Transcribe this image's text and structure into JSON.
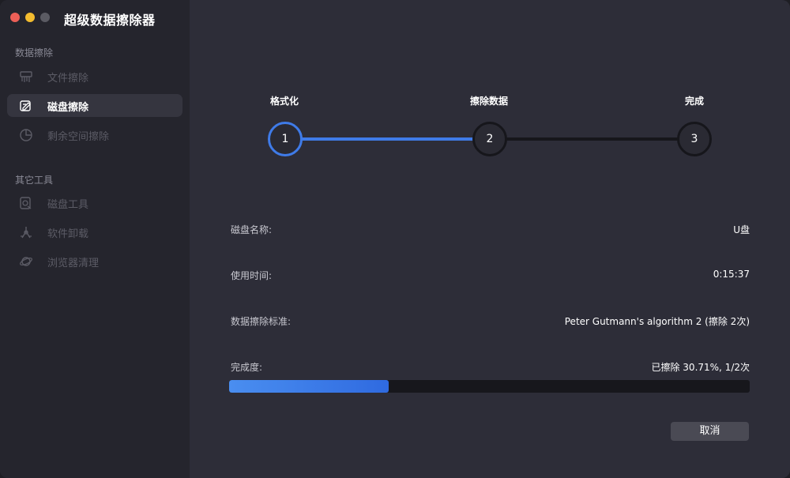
{
  "window": {
    "title": "超级数据擦除器",
    "traffic_lights": [
      "close",
      "minimize",
      "zoom"
    ]
  },
  "sidebar": {
    "sections": [
      {
        "title": "数据擦除",
        "items": [
          {
            "label": "文件擦除",
            "icon": "shredder-icon",
            "active": false
          },
          {
            "label": "磁盘擦除",
            "icon": "disk-edit-icon",
            "active": true
          },
          {
            "label": "剩余空间擦除",
            "icon": "pie-chart-icon",
            "active": false
          }
        ]
      },
      {
        "title": "其它工具",
        "items": [
          {
            "label": "磁盘工具",
            "icon": "disk-tool-icon",
            "active": false
          },
          {
            "label": "软件卸载",
            "icon": "uninstall-icon",
            "active": false
          },
          {
            "label": "浏览器清理",
            "icon": "planet-icon",
            "active": false
          }
        ]
      }
    ]
  },
  "steps": [
    {
      "number": "1",
      "label": "格式化",
      "state": "done"
    },
    {
      "number": "2",
      "label": "擦除数据",
      "state": "current"
    },
    {
      "number": "3",
      "label": "完成",
      "state": "pending"
    }
  ],
  "details": {
    "disk_name_label": "磁盘名称:",
    "disk_name_value": "U盘",
    "time_used_label": "使用时间:",
    "time_used_value": "0:15:37",
    "standard_label": "数据擦除标准:",
    "standard_value": "Peter Gutmann's algorithm 2 (擦除 2次)",
    "progress_label": "完成度:",
    "progress_value": "已擦除 30.71%, 1/2次",
    "progress_fraction": 0.3071
  },
  "cancel_button": "取消",
  "colors": {
    "accent": "#3f7be8",
    "background": "#2d2d38",
    "sidebar": "#25252d"
  }
}
